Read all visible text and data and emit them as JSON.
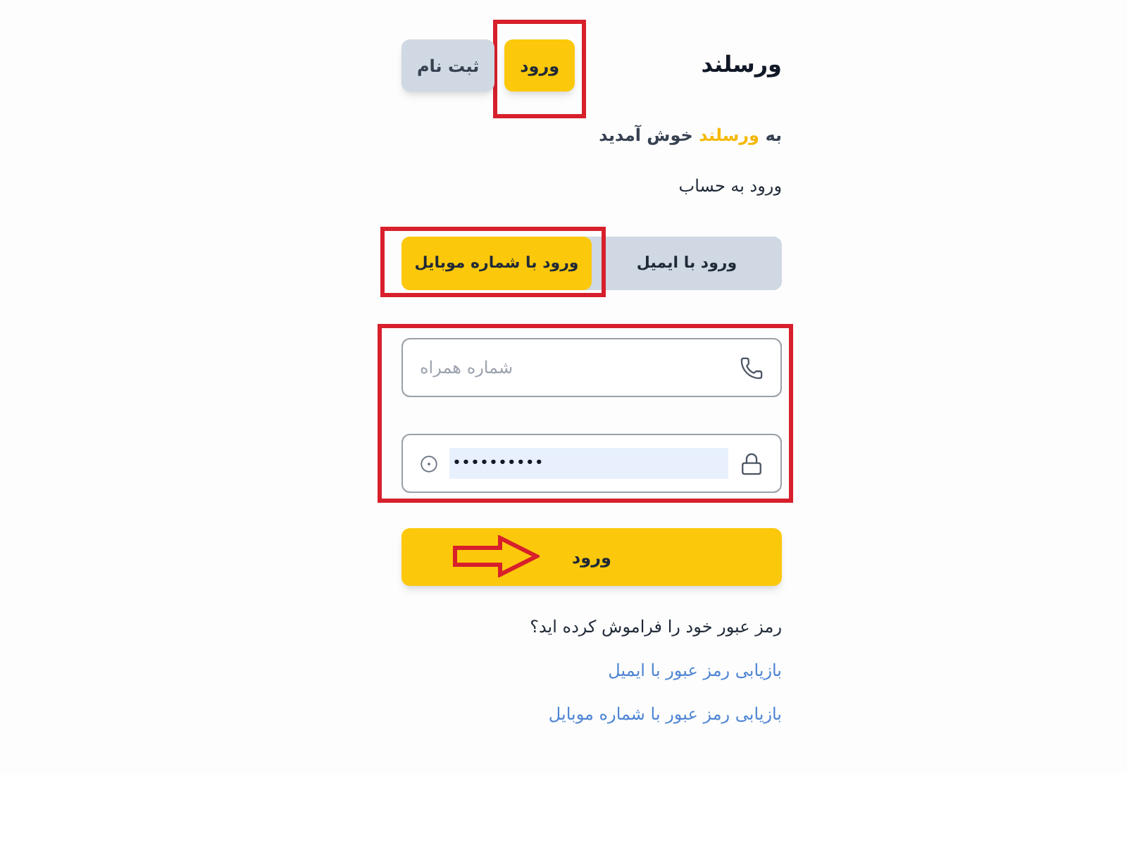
{
  "header": {
    "title": "ورسلند"
  },
  "auth_tabs": [
    {
      "label": "ورود",
      "selected": true,
      "highlighted": true
    },
    {
      "label": "ثبت نام",
      "selected": false,
      "highlighted": false
    }
  ],
  "welcome": {
    "before": "به",
    "brand": "ورسلند",
    "after": "خوش آمدید"
  },
  "subtitle": "ورود به حساب",
  "method_tabs": [
    {
      "label": "ورود با ایمیل",
      "selected": false,
      "highlighted": false
    },
    {
      "label": "ورود با شماره موبایل",
      "selected": true,
      "highlighted": true
    }
  ],
  "fields_highlighted": true,
  "fields": [
    {
      "kind": "phone",
      "placeholder": "شماره همراه"
    },
    {
      "kind": "password",
      "value": "••••••••••",
      "autofilled": true
    }
  ],
  "submit": {
    "label": "ورود",
    "pointer_arrow": true
  },
  "forgot": {
    "question": "رمز عبور خود را فراموش کرده اید؟",
    "links": [
      "بازیابی رمز عبور با ایمیل",
      "بازیابی رمز عبور با شماره موبایل"
    ]
  }
}
